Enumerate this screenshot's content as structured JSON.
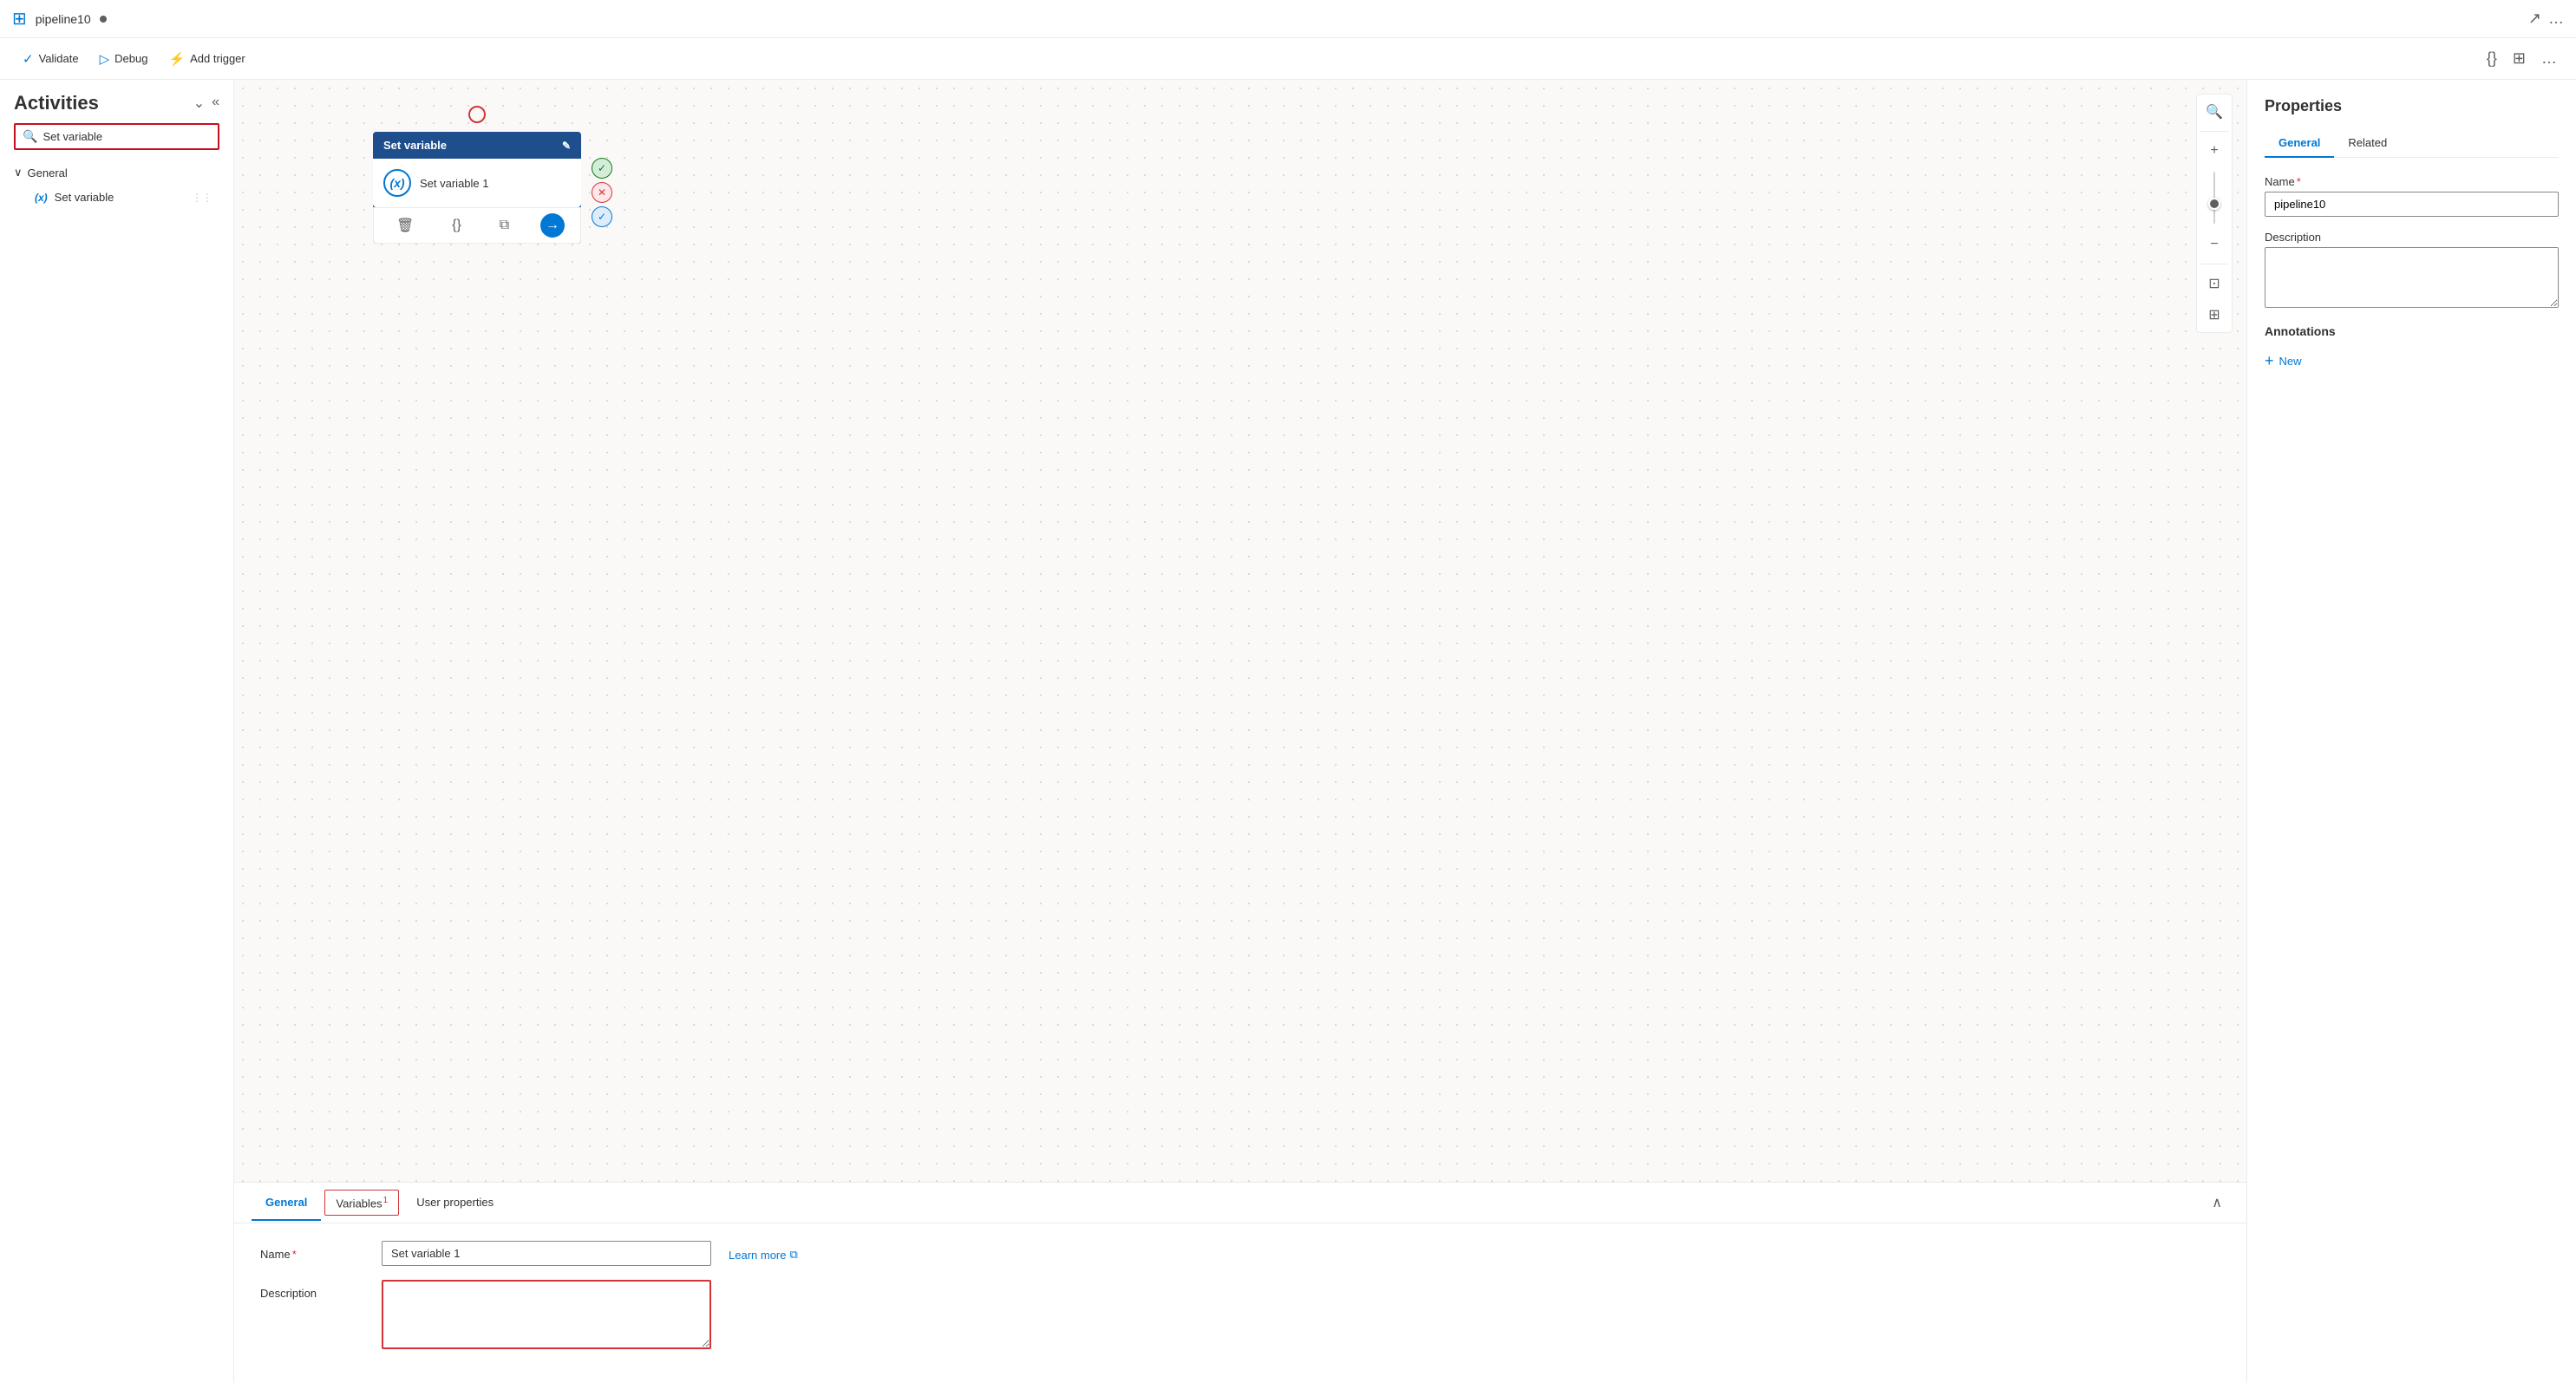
{
  "titleBar": {
    "icon": "⊞",
    "name": "pipeline10",
    "dot": true,
    "actions": [
      "↗",
      "…"
    ]
  },
  "commandBar": {
    "validateLabel": "Validate",
    "debugLabel": "Debug",
    "addTriggerLabel": "Add trigger",
    "rightActions": [
      "{}",
      "⊞",
      "…"
    ]
  },
  "sidebar": {
    "title": "Activities",
    "searchPlaceholder": "Set variable",
    "searchValue": "Set variable",
    "collapseIcon": "⌄",
    "hideIcon": "«",
    "sections": [
      {
        "label": "General",
        "expanded": true,
        "items": [
          {
            "label": "Set variable",
            "icon": "(x)"
          }
        ]
      }
    ]
  },
  "canvas": {
    "node": {
      "startDot": true,
      "headerLabel": "Set variable",
      "bodyIcon": "x",
      "bodyLabel": "Set variable 1",
      "sideActions": [
        "✓",
        "✕",
        "✓"
      ],
      "actionButtons": [
        "🗑",
        "{}",
        "⧉",
        "→"
      ]
    }
  },
  "bottomPanel": {
    "tabs": [
      {
        "label": "General",
        "active": true,
        "badge": false,
        "outlined": false
      },
      {
        "label": "Variables",
        "active": false,
        "badge": true,
        "badgeNum": "1",
        "outlined": true
      },
      {
        "label": "User properties",
        "active": false,
        "badge": false,
        "outlined": false
      }
    ],
    "collapseLabel": "∧",
    "nameLabel": "Name",
    "nameRequired": "*",
    "nameValue": "Set variable 1",
    "learnMoreLabel": "Learn more",
    "learnMoreIcon": "⧉",
    "descriptionLabel": "Description",
    "descriptionValue": ""
  },
  "propertiesPanel": {
    "title": "Properties",
    "tabs": [
      {
        "label": "General",
        "active": true
      },
      {
        "label": "Related",
        "active": false
      }
    ],
    "nameLabel": "Name",
    "nameRequired": "*",
    "nameValue": "pipeline10",
    "descriptionLabel": "Description",
    "descriptionValue": "",
    "annotationsLabel": "Annotations",
    "addNewLabel": "New"
  }
}
